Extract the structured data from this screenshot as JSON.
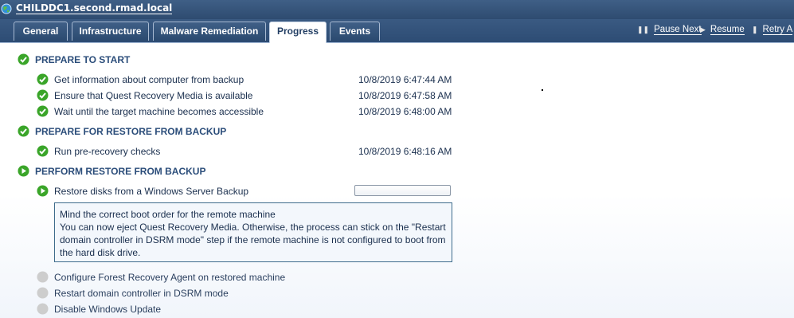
{
  "window": {
    "title": "CHILDDC1.second.rmad.local"
  },
  "tabs": [
    {
      "label": "General"
    },
    {
      "label": "Infrastructure"
    },
    {
      "label": "Malware Remediation"
    },
    {
      "label": "Progress"
    },
    {
      "label": "Events"
    }
  ],
  "actions": {
    "pause_next": "Pause Next",
    "resume": "Resume",
    "retry": "Retry A"
  },
  "sections": {
    "prepare": {
      "title": "PREPARE TO START",
      "steps": [
        {
          "label": "Get information about computer from backup",
          "time": "10/8/2019 6:47:44 AM"
        },
        {
          "label": "Ensure that Quest Recovery Media is available",
          "time": "10/8/2019 6:47:58 AM"
        },
        {
          "label": "Wait until the target machine becomes accessible",
          "time": "10/8/2019 6:48:00 AM"
        }
      ]
    },
    "prepare_restore": {
      "title": "PREPARE FOR RESTORE FROM BACKUP",
      "steps": [
        {
          "label": "Run pre-recovery checks",
          "time": "10/8/2019 6:48:16 AM"
        }
      ]
    },
    "perform": {
      "title": "PERFORM RESTORE FROM BACKUP",
      "steps": [
        {
          "label": "Restore disks from a Windows Server Backup",
          "progress": 0
        },
        {
          "label": "Configure Forest Recovery Agent on restored machine"
        },
        {
          "label": "Restart domain controller in DSRM mode"
        },
        {
          "label": "Disable Windows Update"
        }
      ],
      "message": {
        "line1": "Mind the correct boot order for the remote machine",
        "line2": "You can now eject Quest Recovery Media. Otherwise, the process can stick on the \"Restart domain controller in DSRM mode\" step if the remote machine is not configured to boot from the hard disk drive."
      }
    }
  },
  "colors": {
    "accent": "#2d4c74",
    "success": "#3aa529",
    "pending": "#c8c8c8"
  }
}
